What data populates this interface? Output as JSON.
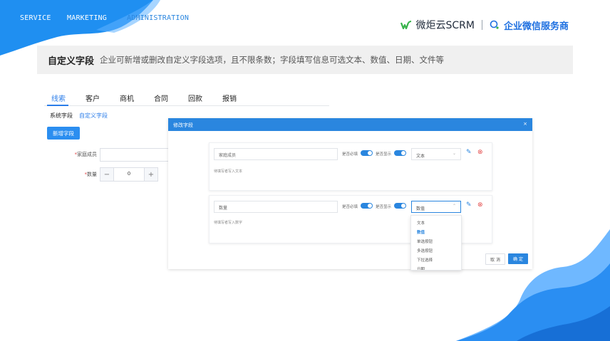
{
  "nav": {
    "items": [
      {
        "label": "SERVICE"
      },
      {
        "label": "MARKETING"
      },
      {
        "label": "ADMINISTRATION"
      }
    ]
  },
  "brand": {
    "wechat_text": "微炬云SCRM",
    "service_text": "企业微信服务商"
  },
  "banner": {
    "title": "自定义字段",
    "description": "企业可新增或删改自定义字段选项，且不限条数；字段填写信息可选文本、数值、日期、文件等"
  },
  "app": {
    "tabs": [
      "线索",
      "客户",
      "商机",
      "合同",
      "回款",
      "报销"
    ],
    "subtabs": [
      "系统字段",
      "自定义字段"
    ],
    "new_button": "新增字段",
    "form": {
      "member_label": "家庭成员",
      "quantity_label": "数量",
      "required_mark": "*",
      "quantity_value": "0",
      "minus": "−",
      "plus": "+"
    }
  },
  "modal": {
    "title": "修改字段",
    "close": "×",
    "cards": [
      {
        "name": "家庭成员",
        "required_label": "是否必填",
        "show_label": "是否显示",
        "type": "文本",
        "hint": "待填写者写入文本"
      },
      {
        "name": "数量",
        "required_label": "是否必填",
        "show_label": "是否显示",
        "type": "数值",
        "hint": "待填写者写入数字"
      }
    ],
    "dropdown_options": [
      "文本",
      "数值",
      "单选按钮",
      "多选按钮",
      "下拉选择",
      "日期"
    ],
    "dropdown_selected": "数值",
    "cancel": "取 消",
    "confirm": "确 定"
  },
  "colors": {
    "primary": "#2a86df",
    "wave": "#1f8ff1",
    "brand_green": "#37b34a",
    "brand_blue": "#1d6fe0",
    "delete_red": "#e34b4b"
  }
}
